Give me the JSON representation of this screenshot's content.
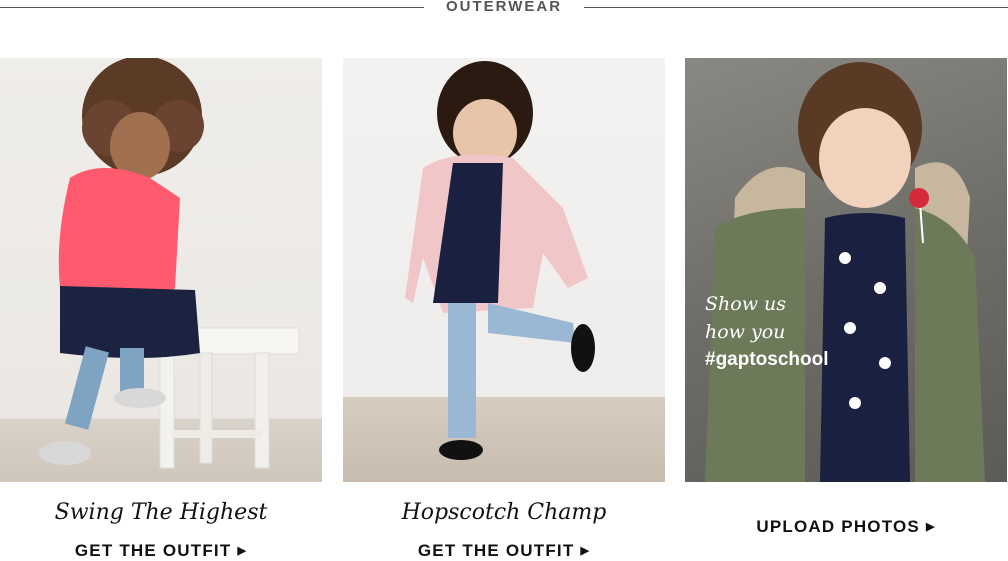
{
  "section": {
    "title": "OUTERWEAR"
  },
  "tiles": [
    {
      "caption": "Swing The Highest",
      "cta": "GET THE OUTFIT",
      "arrow_icon": "caret-right-icon",
      "colors": {
        "bg": "#efedea",
        "jacket": "#ff5a6e",
        "skirt": "#1b2340"
      }
    },
    {
      "caption": "Hopscotch Champ",
      "cta": "GET THE OUTFIT",
      "arrow_icon": "caret-right-icon",
      "colors": {
        "bg": "#f3f2f0",
        "jacket": "#f1c6c8",
        "top": "#1a2140"
      }
    },
    {
      "overlay_line1": "Show us",
      "overlay_line2": "how you",
      "overlay_tag": "#gaptoschool",
      "cta": "UPLOAD PHOTOS",
      "arrow_icon": "caret-right-icon",
      "colors": {
        "bg": "#7a7873",
        "parka": "#6c7a5a",
        "fur": "#c7b79f"
      }
    }
  ]
}
